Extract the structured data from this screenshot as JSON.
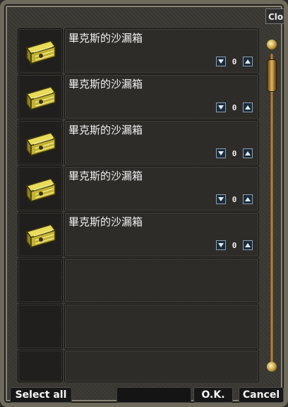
{
  "window": {
    "close_tab_label": "Clo"
  },
  "items": [
    {
      "name": "畢克斯的沙漏箱",
      "quantity": "0",
      "icon": "treasure-chest-icon"
    },
    {
      "name": "畢克斯的沙漏箱",
      "quantity": "0",
      "icon": "treasure-chest-icon"
    },
    {
      "name": "畢克斯的沙漏箱",
      "quantity": "0",
      "icon": "treasure-chest-icon"
    },
    {
      "name": "畢克斯的沙漏箱",
      "quantity": "0",
      "icon": "treasure-chest-icon"
    },
    {
      "name": "畢克斯的沙漏箱",
      "quantity": "0",
      "icon": "treasure-chest-icon"
    }
  ],
  "empty_slots": 3,
  "footer": {
    "select_all_label": "Select all",
    "ok_label": "O.K.",
    "cancel_label": "Cancel"
  },
  "colors": {
    "chest_gold": "#d6c23a",
    "scroll_gold": "#c7913e",
    "stepper_blue": "#1c2b3a"
  }
}
